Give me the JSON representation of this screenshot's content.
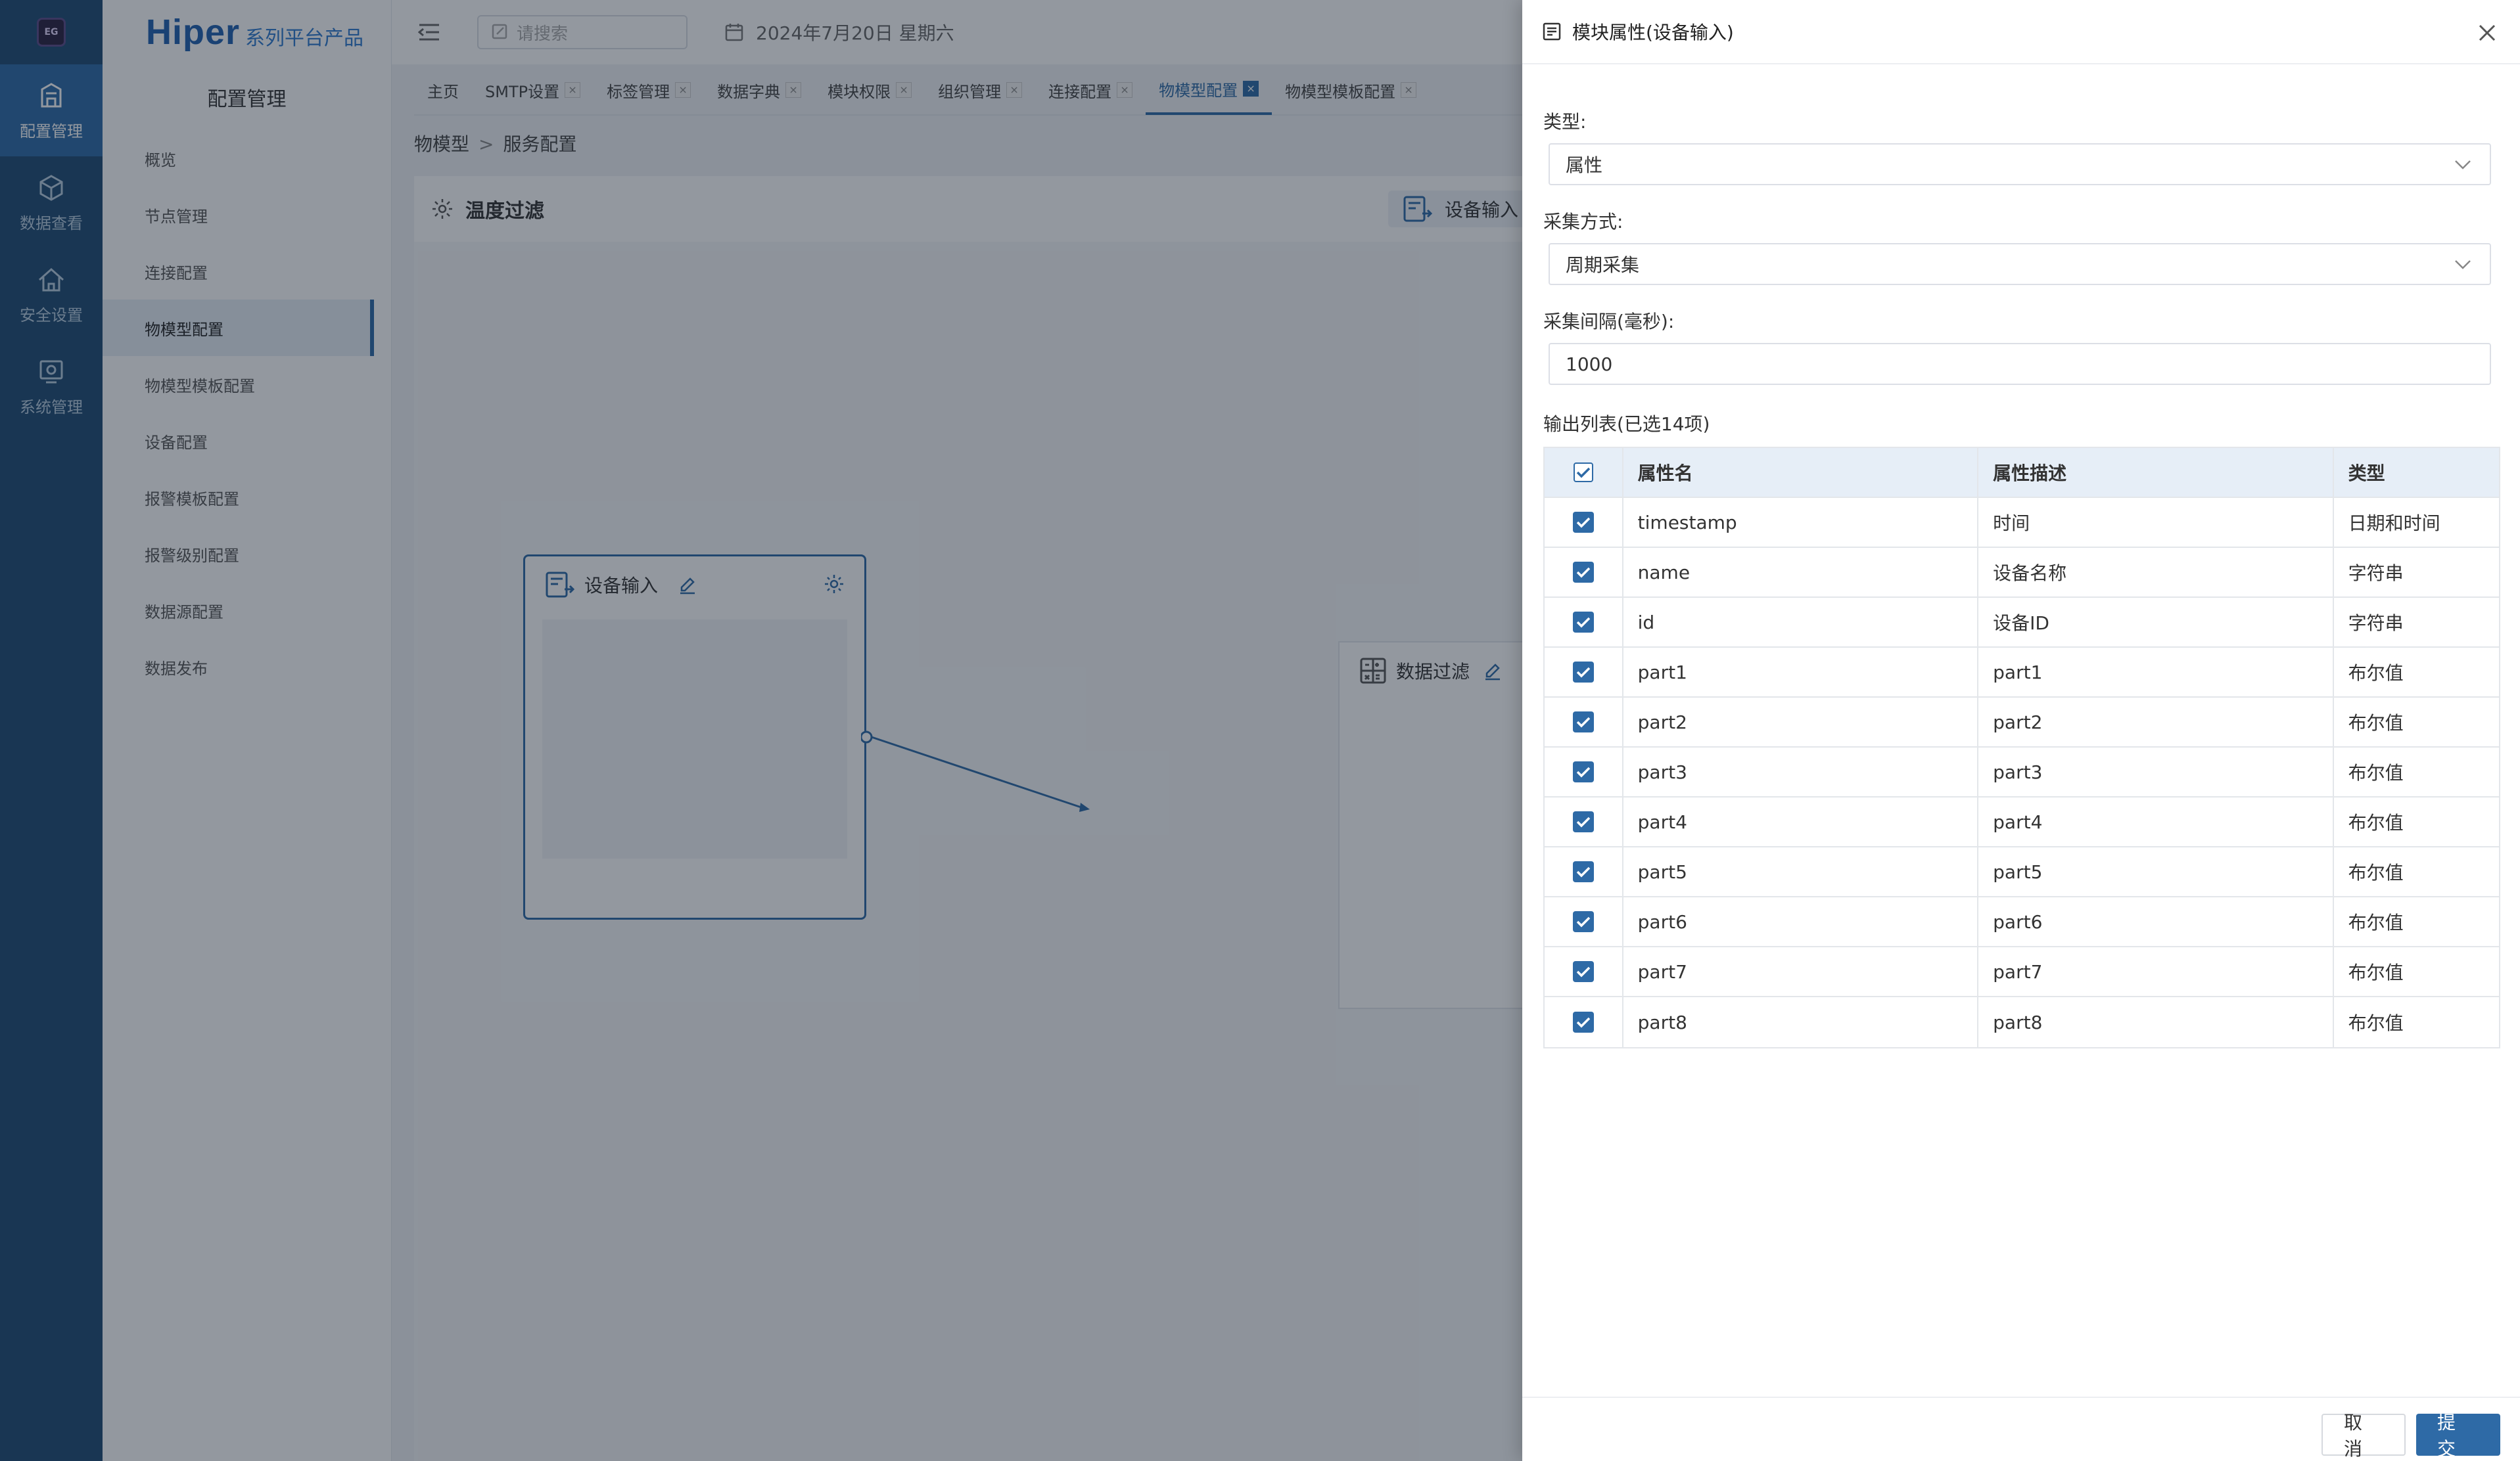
{
  "rail": {
    "logo_text": "EG",
    "items": [
      {
        "label": "配置管理",
        "icon": "building-icon",
        "active": true
      },
      {
        "label": "数据查看",
        "icon": "cube-icon",
        "active": false
      },
      {
        "label": "安全设置",
        "icon": "house-shield-icon",
        "active": false
      },
      {
        "label": "系统管理",
        "icon": "system-gear-icon",
        "active": false
      }
    ]
  },
  "brand": {
    "name": "Hiper",
    "subtitle": "系列平台产品"
  },
  "sidebar": {
    "title": "配置管理",
    "items": [
      {
        "label": "概览"
      },
      {
        "label": "节点管理"
      },
      {
        "label": "连接配置"
      },
      {
        "label": "物模型配置",
        "active": true
      },
      {
        "label": "物模型模板配置"
      },
      {
        "label": "设备配置"
      },
      {
        "label": "报警模板配置"
      },
      {
        "label": "报警级别配置"
      },
      {
        "label": "数据源配置"
      },
      {
        "label": "数据发布"
      }
    ]
  },
  "topbar": {
    "search_placeholder": "请搜索",
    "date": "2024年7月20日 星期六"
  },
  "tabs": [
    {
      "label": "主页",
      "closable": false
    },
    {
      "label": "SMTP设置",
      "closable": true
    },
    {
      "label": "标签管理",
      "closable": true
    },
    {
      "label": "数据字典",
      "closable": true
    },
    {
      "label": "模块权限",
      "closable": true
    },
    {
      "label": "组织管理",
      "closable": true
    },
    {
      "label": "连接配置",
      "closable": true
    },
    {
      "label": "物模型配置",
      "closable": true,
      "active": true
    },
    {
      "label": "物模型模板配置",
      "closable": true
    }
  ],
  "breadcrumb": {
    "root": "物模型",
    "sep": ">",
    "current": "服务配置"
  },
  "workspace": {
    "title": "温度过滤",
    "palette_item": "设备输入",
    "nodes": [
      {
        "title": "设备输入"
      },
      {
        "title": "数据过滤"
      }
    ]
  },
  "drawer": {
    "title": "模块属性(设备输入)",
    "type_label": "类型:",
    "type_value": "属性",
    "collect_label": "采集方式:",
    "collect_value": "周期采集",
    "interval_label": "采集间隔(毫秒):",
    "interval_value": "1000",
    "output_label": "输出列表(已选14项)",
    "columns": [
      "属性名",
      "属性描述",
      "类型"
    ],
    "rows": [
      {
        "name": "timestamp",
        "desc": "时间",
        "type": "日期和时间"
      },
      {
        "name": "name",
        "desc": "设备名称",
        "type": "字符串"
      },
      {
        "name": "id",
        "desc": "设备ID",
        "type": "字符串"
      },
      {
        "name": "part1",
        "desc": "part1",
        "type": "布尔值"
      },
      {
        "name": "part2",
        "desc": "part2",
        "type": "布尔值"
      },
      {
        "name": "part3",
        "desc": "part3",
        "type": "布尔值"
      },
      {
        "name": "part4",
        "desc": "part4",
        "type": "布尔值"
      },
      {
        "name": "part5",
        "desc": "part5",
        "type": "布尔值"
      },
      {
        "name": "part6",
        "desc": "part6",
        "type": "布尔值"
      },
      {
        "name": "part7",
        "desc": "part7",
        "type": "布尔值"
      },
      {
        "name": "part8",
        "desc": "part8",
        "type": "布尔值"
      }
    ],
    "cancel_label": "取消",
    "submit_label": "提交"
  },
  "colors": {
    "accent": "#2e6aa6",
    "rail": "#1e4a73",
    "overlay": "rgba(20,30,45,0.46)"
  }
}
